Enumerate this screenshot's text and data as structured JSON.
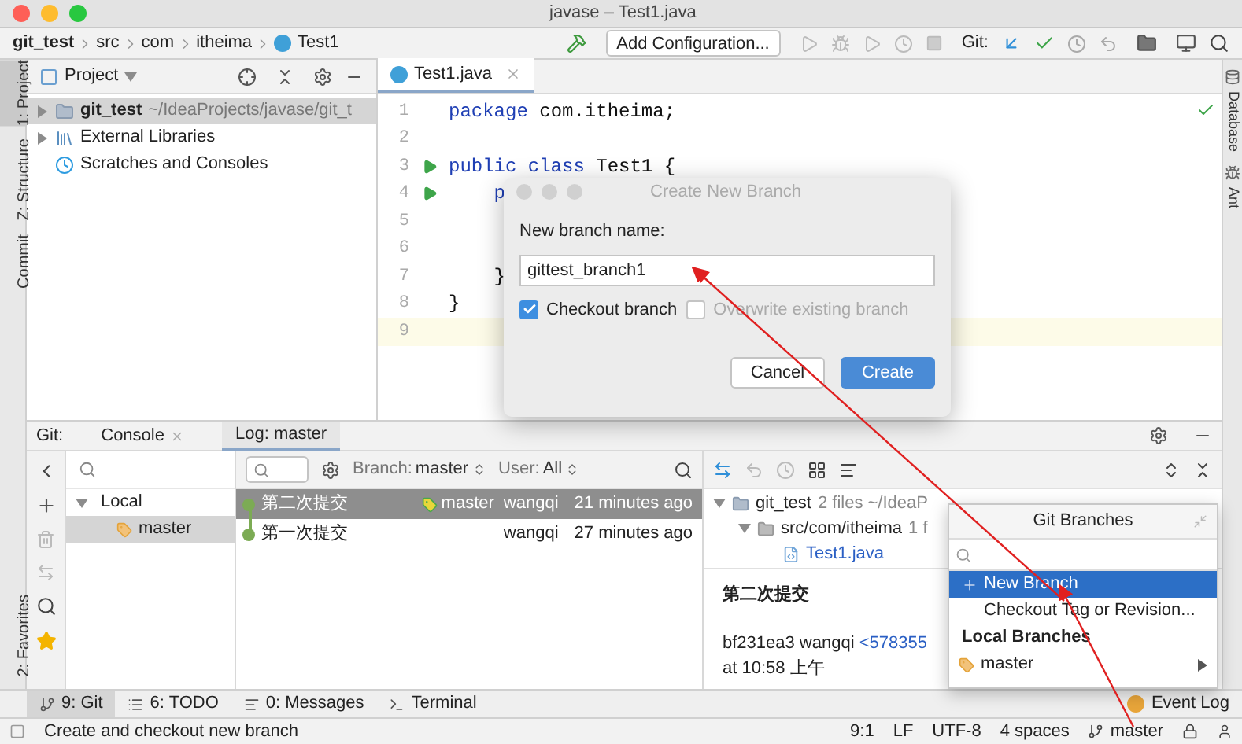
{
  "window": {
    "title": "javase – Test1.java"
  },
  "breadcrumbs": [
    "git_test",
    "src",
    "com",
    "itheima",
    "Test1"
  ],
  "toolbar": {
    "run_config": "Add Configuration...",
    "git_label": "Git:"
  },
  "left_stripe": {
    "top": [
      {
        "label": "1: Project",
        "selected": true
      },
      {
        "label": "Z: Structure",
        "selected": false
      },
      {
        "label": "Commit",
        "selected": false
      }
    ],
    "bottom": [
      {
        "label": "2: Favorites",
        "selected": false
      }
    ]
  },
  "right_stripe": [
    "Database",
    "Ant"
  ],
  "project_panel": {
    "title": "Project",
    "tree": [
      {
        "kind": "module",
        "label": "git_test",
        "path": "~/IdeaProjects/javase/git_t",
        "selected": true
      },
      {
        "kind": "library",
        "label": "External Libraries",
        "selected": false
      },
      {
        "kind": "scratches",
        "label": "Scratches and Consoles",
        "selected": false
      }
    ]
  },
  "editor": {
    "tab": "Test1.java",
    "lines": [
      {
        "number": "1",
        "run": false,
        "current": false,
        "tokens": [
          {
            "kind": "keyword",
            "text": "package"
          },
          {
            "kind": "plain",
            "text": " com.itheima;"
          }
        ]
      },
      {
        "number": "2",
        "run": false,
        "current": false
      },
      {
        "number": "3",
        "run": true,
        "current": false,
        "tokens": [
          {
            "kind": "keyword",
            "text": "public class"
          },
          {
            "kind": "plain",
            "text": " Test1 {"
          }
        ]
      },
      {
        "number": "4",
        "run": true,
        "current": false,
        "tokens": [
          {
            "kind": "keyword",
            "text": "    p"
          }
        ]
      },
      {
        "number": "5",
        "run": false,
        "current": false
      },
      {
        "number": "6",
        "run": false,
        "current": false
      },
      {
        "number": "7",
        "run": false,
        "current": false,
        "tokens": [
          {
            "kind": "plain",
            "text": "    }"
          }
        ]
      },
      {
        "number": "8",
        "run": false,
        "current": false,
        "tokens": [
          {
            "kind": "plain",
            "text": "}"
          }
        ]
      },
      {
        "number": "9",
        "run": false,
        "current": true
      }
    ]
  },
  "dialog": {
    "title": "Create New Branch",
    "label": "New branch name:",
    "value": "gittest_branch1",
    "options": [
      {
        "label": "Checkout branch",
        "checked": true,
        "disabled": false
      },
      {
        "label": "Overwrite existing branch",
        "checked": false,
        "disabled": true
      }
    ],
    "buttons": [
      {
        "label": "Cancel",
        "primary": false
      },
      {
        "label": "Create",
        "primary": true
      }
    ]
  },
  "git_window": {
    "label": "Git:",
    "tabs": [
      {
        "label": "Console",
        "selected": false
      },
      {
        "label": "Log: master",
        "selected": true
      }
    ],
    "branches": [
      {
        "label": "Local",
        "children": [
          {
            "label": "master",
            "selected": true
          }
        ]
      }
    ],
    "filters": [
      {
        "label": "Branch:",
        "value": "master"
      },
      {
        "label": "User:",
        "value": "All"
      }
    ],
    "commits": [
      {
        "message": "第二次提交",
        "tag": "master",
        "author": "wangqi",
        "time": "21 minutes ago",
        "selected": true
      },
      {
        "message": "第一次提交",
        "author": "wangqi",
        "time": "27 minutes ago",
        "selected": false
      }
    ],
    "changes": [
      {
        "label": "git_test",
        "info": "2 files ~/IdeaP",
        "children": [
          {
            "label": "src/com/itheima",
            "info": "1 f",
            "children": [
              {
                "label": "Test1.java"
              }
            ]
          }
        ]
      }
    ],
    "details": {
      "message": "第二次提交",
      "hash": "bf231ea3 wangqi",
      "email": "<578355",
      "time": "at 10:58 上午"
    }
  },
  "popup": {
    "title": "Git Branches",
    "actions": [
      {
        "kind": "new",
        "label": "New Branch",
        "selected": true
      },
      {
        "kind": "plain",
        "label": "Checkout Tag or Revision...",
        "selected": false
      }
    ],
    "section": "Local Branches",
    "branches": [
      {
        "label": "master"
      }
    ]
  },
  "tool_buttons": [
    {
      "label": "9: Git",
      "selected": true,
      "kind": "git"
    },
    {
      "label": "6: TODO",
      "selected": false,
      "kind": "todo"
    },
    {
      "label": "0: Messages",
      "selected": false,
      "kind": "messages"
    },
    {
      "label": "Terminal",
      "selected": false,
      "kind": "terminal"
    }
  ],
  "event_log": "Event Log",
  "status_bar": {
    "message": "Create and checkout new branch",
    "items": [
      "9:1",
      "LF",
      "UTF-8",
      "4 spaces"
    ],
    "branch": "master"
  }
}
